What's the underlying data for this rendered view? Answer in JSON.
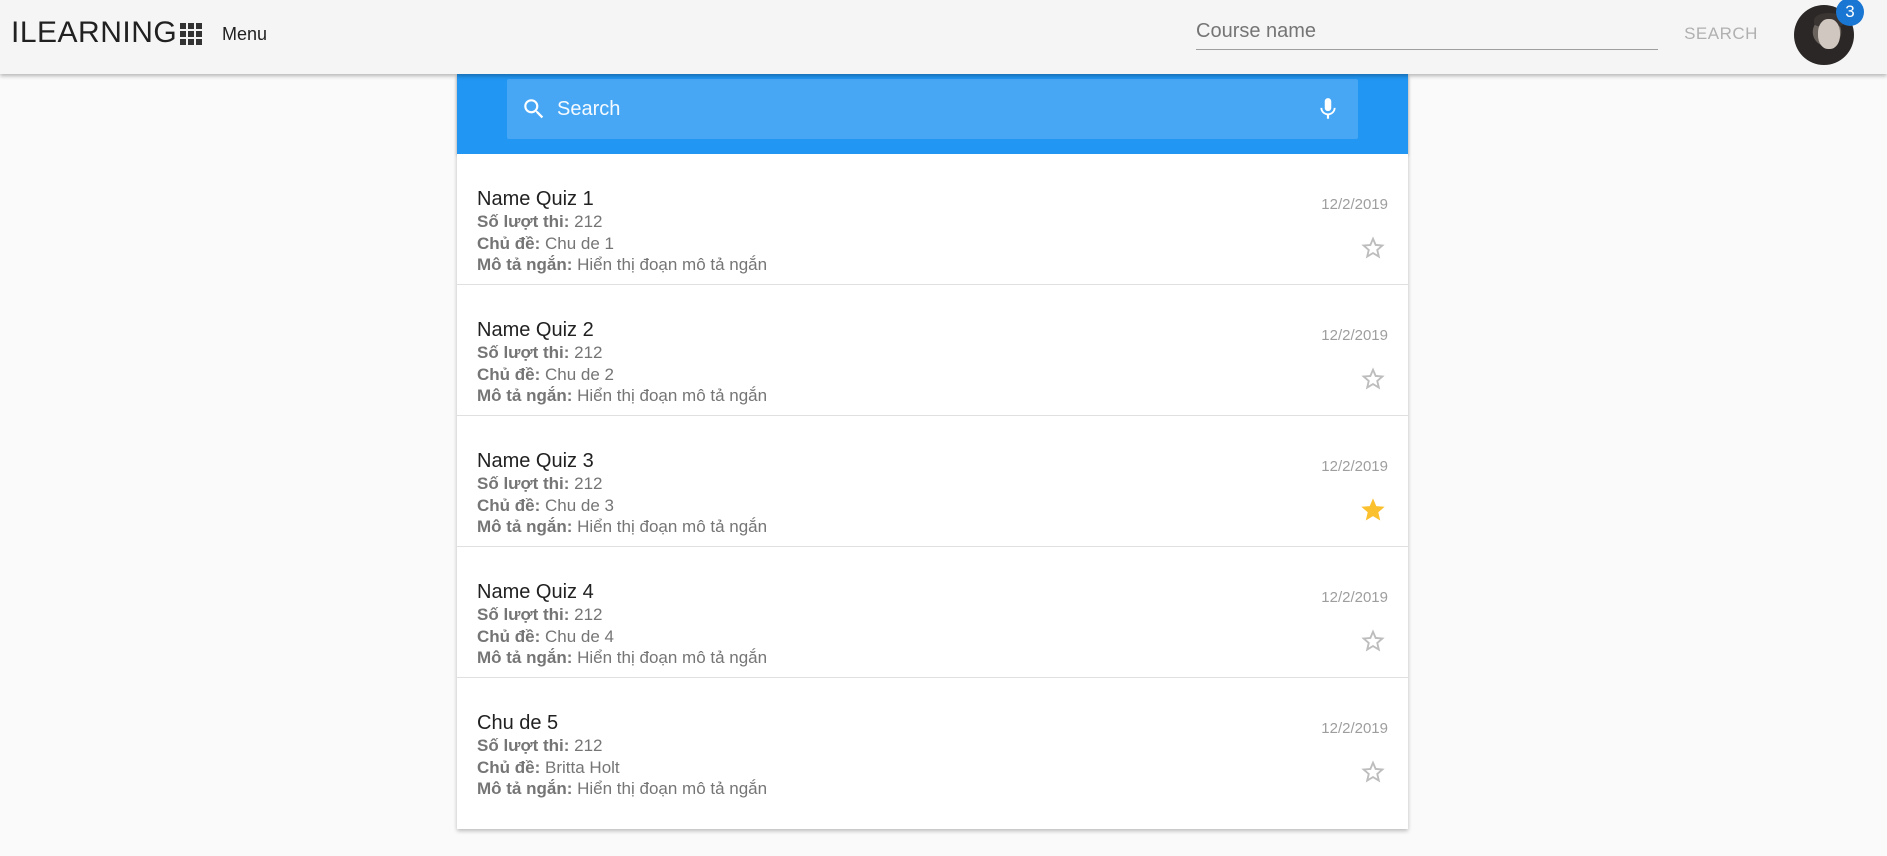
{
  "header": {
    "brand": "ILEARNING",
    "menu_label": "Menu",
    "course_placeholder": "Course name",
    "search_label": "SEARCH",
    "notification_count": "3"
  },
  "search": {
    "placeholder": "Search"
  },
  "labels": {
    "attempts": "Số lượt thi:",
    "topic": "Chủ đề:",
    "description": "Mô tả ngắn:"
  },
  "quizzes": [
    {
      "title": "Name Quiz 1",
      "attempts": "212",
      "topic": "Chu de 1",
      "description": "Hiển thị đoạn mô tả ngắn",
      "date": "12/2/2019",
      "starred": false
    },
    {
      "title": "Name Quiz 2",
      "attempts": "212",
      "topic": "Chu de 2",
      "description": "Hiển thị đoạn mô tả ngắn",
      "date": "12/2/2019",
      "starred": false
    },
    {
      "title": "Name Quiz 3",
      "attempts": "212",
      "topic": "Chu de 3",
      "description": "Hiển thị đoạn mô tả ngắn",
      "date": "12/2/2019",
      "starred": true
    },
    {
      "title": "Name Quiz 4",
      "attempts": "212",
      "topic": "Chu de 4",
      "description": "Hiển thị đoạn mô tả ngắn",
      "date": "12/2/2019",
      "starred": false
    },
    {
      "title": "Chu de 5",
      "attempts": "212",
      "topic": "Britta Holt",
      "description": "Hiển thị đoạn mô tả ngắn",
      "date": "12/2/2019",
      "starred": false
    }
  ],
  "colors": {
    "primary": "#2196f3",
    "search_box": "#47a7f5",
    "star_active": "#fbc02d",
    "star_inactive": "#bdbdbd",
    "badge": "#1976d2"
  },
  "icons": {
    "apps": "apps-grid-icon",
    "search": "search-icon",
    "mic": "mic-icon",
    "star_empty": "star-outline-icon",
    "star_filled": "star-filled-icon"
  }
}
